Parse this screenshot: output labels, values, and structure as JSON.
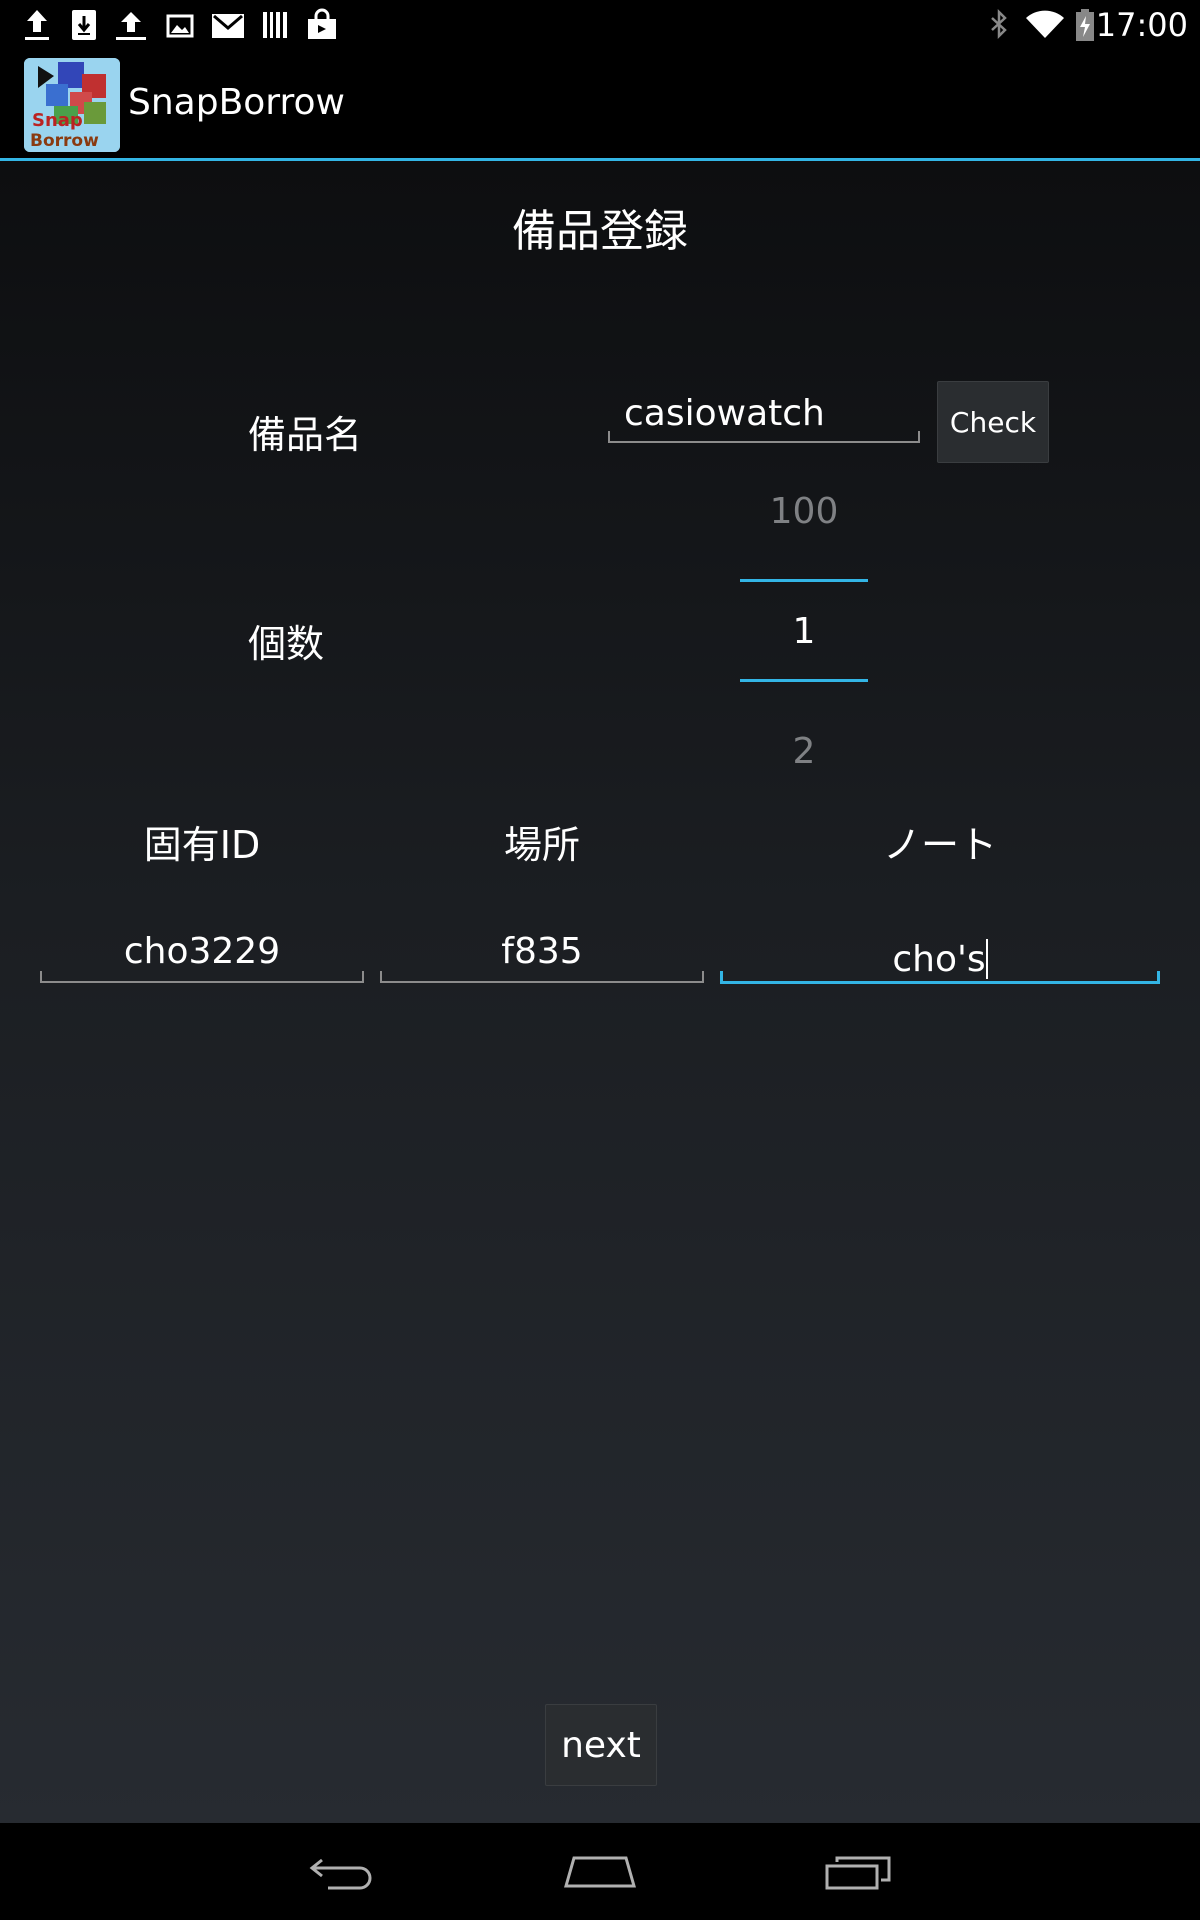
{
  "status_bar": {
    "time": "17:00",
    "left_icons": [
      "upload-icon",
      "download-icon",
      "upload-icon",
      "image-icon",
      "gmail-icon",
      "barcode-icon",
      "shopping-bag-icon"
    ],
    "right_icons": [
      "bluetooth-icon",
      "wifi-icon",
      "battery-charging-icon"
    ]
  },
  "action_bar": {
    "app_name": "SnapBorrow",
    "logo_text_line1": "Snap",
    "logo_text_line2": "Borrow"
  },
  "form": {
    "title": "備品登録",
    "item_name_label": "備品名",
    "item_name_value": "casiowatch",
    "check_button": "Check",
    "quantity_label": "個数",
    "quantity_prev": "100",
    "quantity_current": "1",
    "quantity_next": "2",
    "unique_id_label": "固有ID",
    "location_label": "場所",
    "note_label": "ノート",
    "unique_id_value": "cho3229",
    "location_value": "f835",
    "note_value": "cho's",
    "next_button": "next"
  },
  "colors": {
    "accent": "#33b5e5",
    "background_top": "#0d0e10",
    "background_bottom": "#272b31"
  },
  "nav_bar": {
    "icons": [
      "back-icon",
      "home-icon",
      "recent-apps-icon"
    ]
  }
}
